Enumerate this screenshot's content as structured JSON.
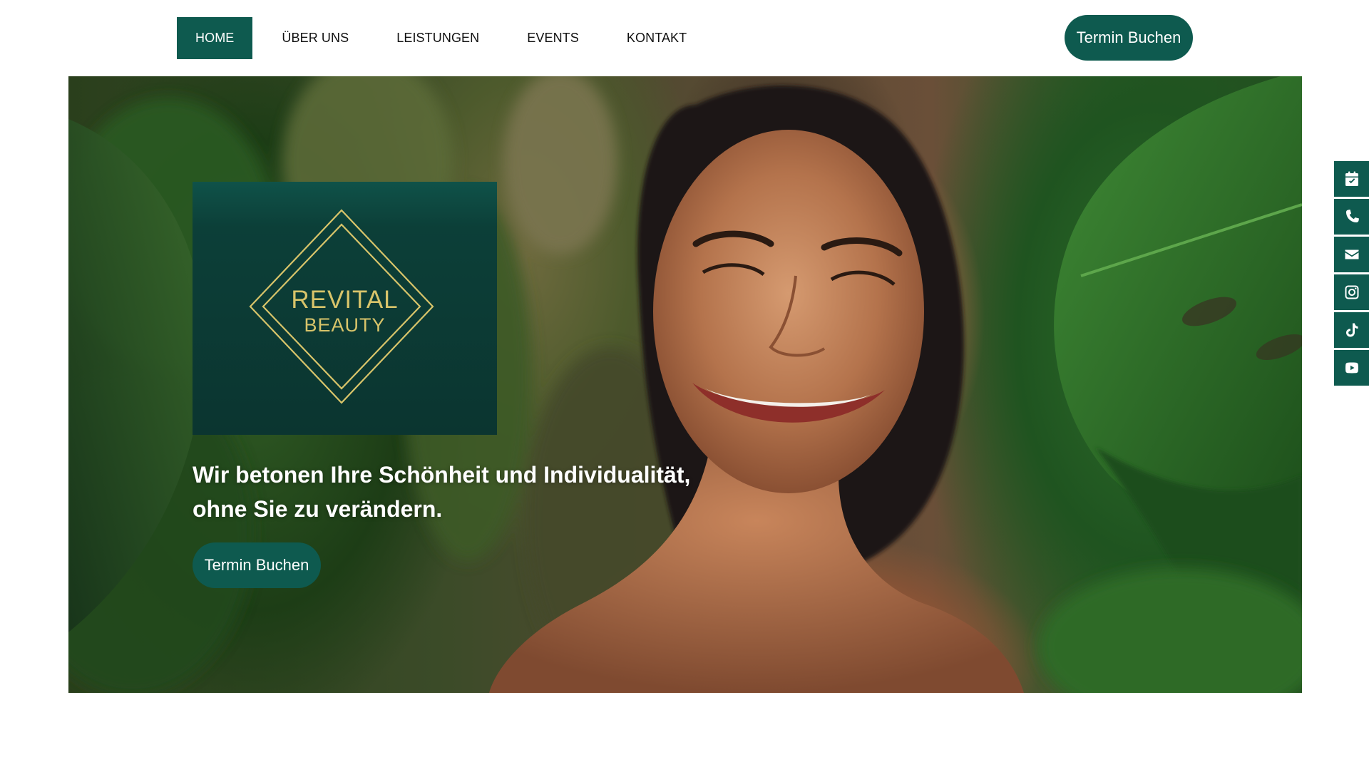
{
  "nav": {
    "items": [
      {
        "label": "HOME",
        "active": true
      },
      {
        "label": "ÜBER UNS",
        "active": false
      },
      {
        "label": "LEISTUNGEN",
        "active": false
      },
      {
        "label": "EVENTS",
        "active": false
      },
      {
        "label": "KONTAKT",
        "active": false
      }
    ],
    "cta_label": "Termin Buchen"
  },
  "hero": {
    "logo": {
      "line1": "REVITAL",
      "line2": "BEAUTY"
    },
    "headline_line1": "Wir betonen Ihre Schönheit und Individualität,",
    "headline_line2": "ohne Sie zu verändern.",
    "cta_label": "Termin Buchen",
    "image": "smiling-woman-with-monstera-leaves-photo"
  },
  "side_bar": {
    "icons": [
      "calendar-check-icon",
      "phone-icon",
      "envelope-icon",
      "instagram-icon",
      "tiktok-icon",
      "youtube-icon"
    ]
  },
  "colors": {
    "brand_green": "#0e5a4f",
    "logo_card": "#0b3530",
    "logo_gold": "#d8c46a",
    "page_background": "#ffffff"
  }
}
